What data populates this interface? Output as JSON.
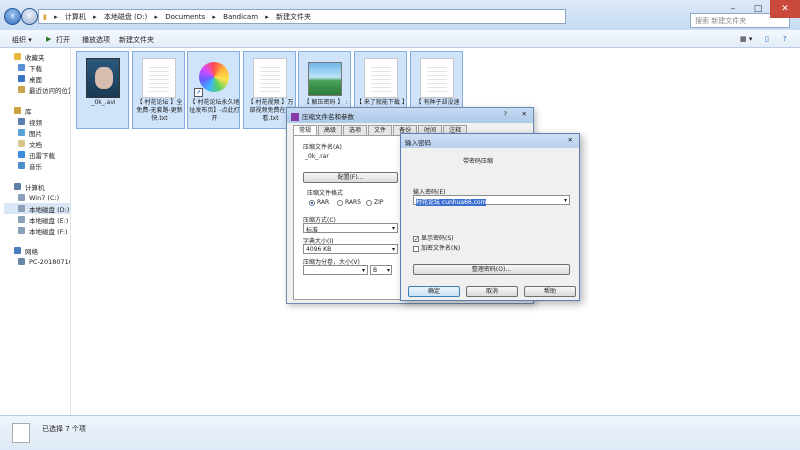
{
  "address": {
    "crumbs": [
      "计算机",
      "本地磁盘 (D:)",
      "Documents",
      "Bandicam",
      "新建文件夹"
    ],
    "arrow": "▸"
  },
  "search": {
    "placeholder": "搜索 新建文件夹"
  },
  "window_controls": {
    "minimize": "–",
    "maximize": "□",
    "close": "✕"
  },
  "toolbar": {
    "organize": "组织 ▾",
    "open": "打开",
    "play": "播放选项",
    "new_folder": "新建文件夹",
    "view": "▦ ▾",
    "help": "?"
  },
  "sidebar": {
    "favorites": "收藏夹",
    "downloads": "下载",
    "desktop": "桌面",
    "recent": "最近访问的位置",
    "libraries": "库",
    "videos": "视频",
    "pictures": "图片",
    "documents": "文档",
    "xunlei": "迅雷下载",
    "music": "音乐",
    "computer": "计算机",
    "win7": "Win7 (C:)",
    "drive_d": "本地磁盘 (D:)",
    "drive_e": "本地磁盘 (E:)",
    "drive_f": "本地磁盘 (F:)",
    "network": "网络",
    "pc": "PC-20180710I"
  },
  "files": [
    {
      "name": "_0k_.avi"
    },
    {
      "name": "【 村花论坛 】全免费-无套路-更新快.txt"
    },
    {
      "name": "【 村花论坛永久地址发布页】-点此打开"
    },
    {
      "name": "【 村花视频 】万部视频免费在线看.txt"
    },
    {
      "name": "【 解压密码 】 :"
    },
    {
      "name": "【 来了就能下载 】"
    },
    {
      "name": "【 有种子却没速"
    }
  ],
  "status": {
    "text": "已选择 7 个项"
  },
  "archive_dialog": {
    "title": "压缩文件名和参数",
    "help_icon": "?",
    "tabs": [
      "常规",
      "高级",
      "选项",
      "文件",
      "备份",
      "时间",
      "注释"
    ],
    "filename_label": "压缩文件名(A)",
    "filename": "_0k_.rar",
    "profile_button": "配置(F)...",
    "format_label": "压缩文件格式",
    "formats": [
      "RAR",
      "RAR5",
      "ZIP"
    ],
    "method_label": "压缩方式(C)",
    "method": "标准",
    "dict_label": "字典大小(I)",
    "dict": "4096 KB",
    "split_label": "压缩为分卷，大小(V)",
    "split_unit": "B"
  },
  "password_dialog": {
    "title": "输入密码",
    "subtitle": "带密码压缩",
    "pwd_label": "输入密码(E)",
    "pwd_value": "村花论坛 cunhua66.com",
    "show_pwd": "显示密码(S)",
    "encrypt_names": "加密文件名(N)",
    "manage_button": "整理密码(O)...",
    "ok": "确定",
    "cancel": "取消",
    "help": "帮助"
  }
}
